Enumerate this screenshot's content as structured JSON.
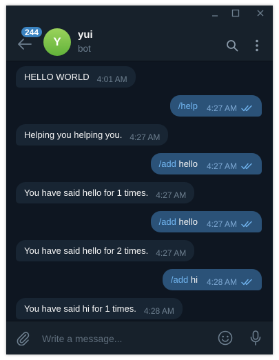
{
  "header": {
    "unread_count": "244",
    "avatar_letter": "Y",
    "chat_name": "yui",
    "chat_status": "bot"
  },
  "messages": [
    {
      "direction": "in",
      "text": "HELLO WORLD",
      "time": "4:01 AM"
    },
    {
      "direction": "out",
      "command": "/help",
      "text": "",
      "time": "4:27 AM",
      "read": true
    },
    {
      "direction": "in",
      "text": "Helping you helping you.",
      "time": "4:27 AM"
    },
    {
      "direction": "out",
      "command": "/add",
      "text": " hello",
      "time": "4:27 AM",
      "read": true
    },
    {
      "direction": "in",
      "text": "You have said hello for 1 times.",
      "time": "4:27 AM"
    },
    {
      "direction": "out",
      "command": "/add",
      "text": " hello",
      "time": "4:27 AM",
      "read": true
    },
    {
      "direction": "in",
      "text": "You have said hello for 2 times.",
      "time": "4:27 AM"
    },
    {
      "direction": "out",
      "command": "/add",
      "text": " hi",
      "time": "4:28 AM",
      "read": true
    },
    {
      "direction": "in",
      "text": "You have said hi for 1 times.",
      "time": "4:28 AM"
    }
  ],
  "composer": {
    "placeholder": "Write a message...",
    "value": ""
  },
  "icons": {
    "minimize": "minimize-icon",
    "maximize": "maximize-icon",
    "close": "close-icon",
    "back": "back-arrow-icon",
    "search": "search-icon",
    "more": "more-vertical-icon",
    "attach": "paperclip-icon",
    "emoji": "smile-icon",
    "mic": "microphone-icon",
    "read_receipt": "double-check-icon"
  },
  "colors": {
    "background": "#0e1621",
    "panel": "#17212b",
    "incoming_bubble": "#182533",
    "outgoing_bubble": "#2b5278",
    "command_link": "#71b5f0",
    "badge": "#3b83c0",
    "muted_text": "#6d7f8f"
  }
}
